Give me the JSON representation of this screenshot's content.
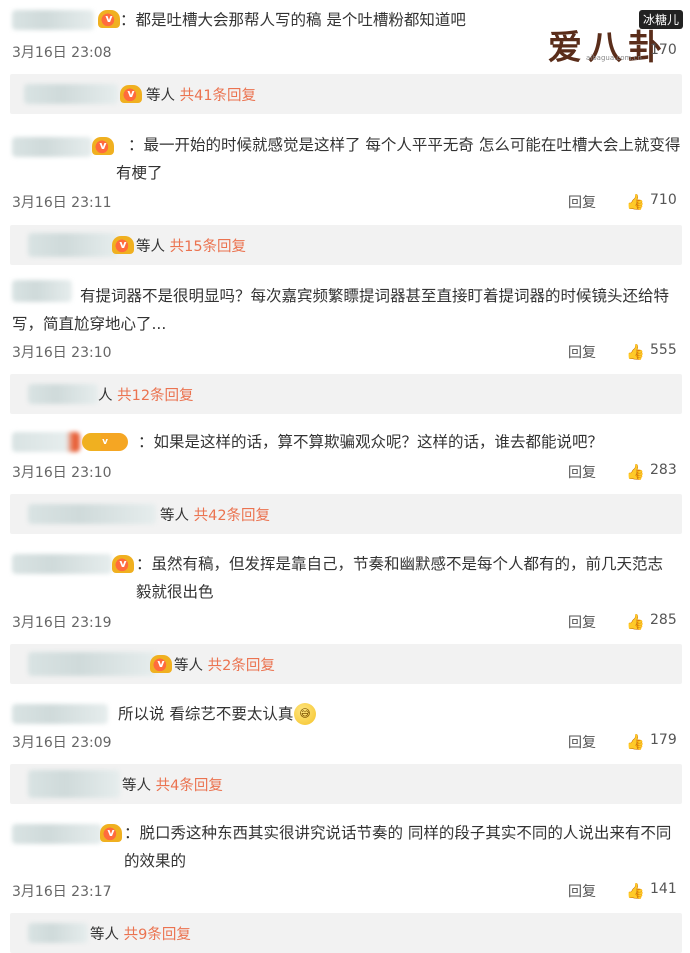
{
  "watermark": {
    "main": "爱八卦",
    "tag": "冰糖儿",
    "url": "aibagua.com.cn"
  },
  "icons": {
    "vip": "vip-crown-icon",
    "like": "thumbs-up-icon",
    "emoji": "embarrassed-emoji-icon"
  },
  "labels": {
    "reply": "回复"
  },
  "comments": [
    {
      "text": "：都是吐槽大会那帮人写的稿  是个吐槽粉都知道吧",
      "date": "3月16日 23:08",
      "likes": "170",
      "sub": {
        "pre": "等人 ",
        "count": "共41条回复"
      }
    },
    {
      "text": "：最一开始的时候就感觉是这样了 每个人平平无奇 怎么可能在吐槽大会上就变得有梗了",
      "date": "3月16日 23:11",
      "likes": "710",
      "sub": {
        "pre": "等人 ",
        "count": "共15条回复"
      }
    },
    {
      "text": "有提词器不是很明显吗？每次嘉宾频繁瞟提词器甚至直接盯着提词器的时候镜头还给特写，简直尬穿地心了...",
      "date": "3月16日 23:10",
      "likes": "555",
      "sub": {
        "pre": "人 ",
        "count": "共12条回复"
      }
    },
    {
      "text": "：如果是这样的话，算不算欺骗观众呢？这样的话，谁去都能说吧？",
      "date": "3月16日 23:10",
      "likes": "283",
      "sub": {
        "pre": "等人 ",
        "count": "共42条回复"
      }
    },
    {
      "text": "：虽然有稿，但发挥是靠自己，节奏和幽默感不是每个人都有的，前几天范志毅就很出色",
      "date": "3月16日 23:19",
      "likes": "285",
      "sub": {
        "pre": "等人 ",
        "count": "共2条回复"
      }
    },
    {
      "text": "所以说 看综艺不要太认真",
      "date": "3月16日 23:09",
      "likes": "179",
      "sub": {
        "pre": "等人 ",
        "count": "共4条回复"
      }
    },
    {
      "text": "：脱口秀这种东西其实很讲究说话节奏的 同样的段子其实不同的人说出来有不同的效果的",
      "date": "3月16日 23:17",
      "likes": "141",
      "sub": {
        "pre": "等人 ",
        "count": "共9条回复"
      }
    }
  ]
}
